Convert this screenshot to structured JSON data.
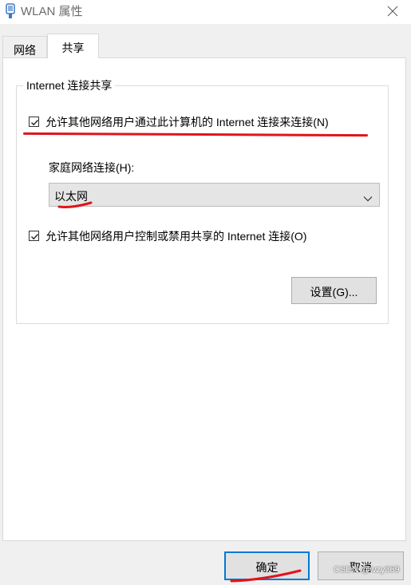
{
  "window": {
    "title": "WLAN 属性",
    "app_icon": "network-adapter-icon",
    "close_icon": "close-icon"
  },
  "tabs": [
    {
      "label": "网络",
      "active": false
    },
    {
      "label": "共享",
      "active": true
    }
  ],
  "sharing": {
    "group_title": "Internet 连接共享",
    "allow_sharing": {
      "label": "允许其他网络用户通过此计算机的 Internet 连接来连接(N)",
      "checked": true
    },
    "home_network_label": "家庭网络连接(H):",
    "home_network_value": "以太网",
    "allow_control": {
      "label": "允许其他网络用户控制或禁用共享的 Internet 连接(O)",
      "checked": true
    },
    "settings_button": "设置(G)..."
  },
  "footer": {
    "ok_button": "确定",
    "cancel_button": "取消"
  },
  "watermark": "CSDN @wzy369",
  "colors": {
    "annotation_red": "#e0141c",
    "accent_blue": "#0078d7"
  }
}
